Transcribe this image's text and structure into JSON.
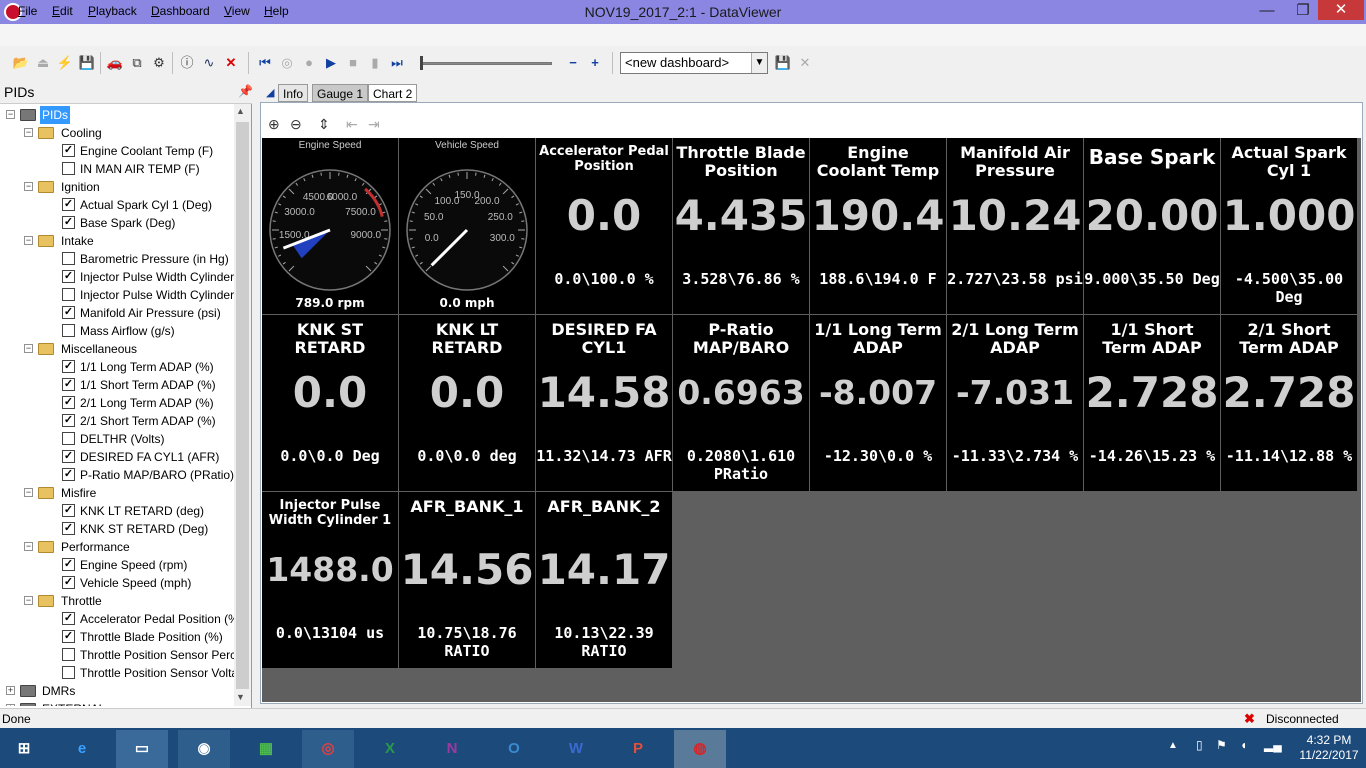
{
  "window": {
    "title": "NOV19_2017_2:1 - DataViewer",
    "minimize": "—",
    "restore": "❐",
    "close": "✕"
  },
  "menu": [
    "File",
    "Edit",
    "Playback",
    "Dashboard",
    "View",
    "Help"
  ],
  "toolbar": {
    "dashboard_select": "<new dashboard>"
  },
  "pids_panel": {
    "title": "PIDs",
    "root": "PIDs",
    "bottom_items": [
      "DMRs",
      "EXTERNAL"
    ],
    "groups": [
      {
        "name": "Cooling",
        "items": [
          {
            "label": "Engine Coolant Temp (F)",
            "checked": true
          },
          {
            "label": "IN MAN AIR TEMP (F)",
            "checked": false
          }
        ]
      },
      {
        "name": "Ignition",
        "items": [
          {
            "label": "Actual Spark Cyl 1 (Deg)",
            "checked": true
          },
          {
            "label": "Base Spark (Deg)",
            "checked": true
          }
        ]
      },
      {
        "name": "Intake",
        "items": [
          {
            "label": "Barometric Pressure (in Hg)",
            "checked": false
          },
          {
            "label": "Injector Pulse Width Cylinder",
            "checked": true
          },
          {
            "label": "Injector Pulse Width Cylinder",
            "checked": false
          },
          {
            "label": "Manifold Air Pressure (psi)",
            "checked": true
          },
          {
            "label": "Mass Airflow (g/s)",
            "checked": false
          }
        ]
      },
      {
        "name": "Miscellaneous",
        "items": [
          {
            "label": "1/1 Long Term ADAP (%)",
            "checked": true
          },
          {
            "label": "1/1 Short Term ADAP (%)",
            "checked": true
          },
          {
            "label": "2/1 Long Term ADAP (%)",
            "checked": true
          },
          {
            "label": "2/1 Short Term ADAP (%)",
            "checked": true
          },
          {
            "label": "DELTHR (Volts)",
            "checked": false
          },
          {
            "label": "DESIRED FA CYL1 (AFR)",
            "checked": true
          },
          {
            "label": "P-Ratio MAP/BARO (PRatio)",
            "checked": true
          }
        ]
      },
      {
        "name": "Misfire",
        "items": [
          {
            "label": "KNK LT RETARD (deg)",
            "checked": true
          },
          {
            "label": "KNK ST RETARD (Deg)",
            "checked": true
          }
        ]
      },
      {
        "name": "Performance",
        "items": [
          {
            "label": "Engine Speed (rpm)",
            "checked": true
          },
          {
            "label": "Vehicle Speed (mph)",
            "checked": true
          }
        ]
      },
      {
        "name": "Throttle",
        "items": [
          {
            "label": "Accelerator Pedal Position (%",
            "checked": true
          },
          {
            "label": "Throttle Blade Position (%)",
            "checked": true
          },
          {
            "label": "Throttle Position Sensor Perc",
            "checked": false
          },
          {
            "label": "Throttle Position Sensor Volta",
            "checked": false
          }
        ]
      }
    ]
  },
  "tabs": [
    "Info",
    "Gauge 1",
    "Chart 2"
  ],
  "gauges": [
    {
      "title": "Engine Speed",
      "value": "789.0 rpm",
      "ticks": [
        "1500.0",
        "3000.0",
        "4500.0",
        "6000.0",
        "7500.0",
        "9000.0"
      ],
      "fraction": 0.088
    },
    {
      "title": "Vehicle Speed",
      "value": "0.0 mph",
      "ticks": [
        "0.0",
        "50.0",
        "100.0",
        "150.0",
        "200.0",
        "250.0",
        "300.0"
      ],
      "fraction": 0.0
    }
  ],
  "cells": [
    {
      "title": "Accelerator Pedal Position",
      "value": "0.0",
      "range": "0.0\\100.0 %"
    },
    {
      "title": "Throttle Blade Position",
      "value": "4.435",
      "range": "3.528\\76.86 %"
    },
    {
      "title": "Engine Coolant Temp",
      "value": "190.4",
      "range": "188.6\\194.0 F"
    },
    {
      "title": "Manifold Air Pressure",
      "value": "10.24",
      "range": "2.727\\23.58 psi"
    },
    {
      "title": "Base Spark",
      "value": "20.00",
      "range": "9.000\\35.50 Deg"
    },
    {
      "title": "Actual Spark Cyl 1",
      "value": "1.000",
      "range": "-4.500\\35.00 Deg"
    },
    {
      "title": "KNK ST RETARD",
      "value": "0.0",
      "range": "0.0\\0.0  Deg"
    },
    {
      "title": "KNK LT RETARD",
      "value": "0.0",
      "range": "0.0\\0.0  deg"
    },
    {
      "title": "DESIRED FA CYL1",
      "value": "14.58",
      "range": "11.32\\14.73 AFR"
    },
    {
      "title": "P-Ratio MAP/BARO",
      "value": "0.6963",
      "range": "0.2080\\1.610 PRatio"
    },
    {
      "title": "1/1 Long Term ADAP",
      "value": "-8.007",
      "range": "-12.30\\0.0 %"
    },
    {
      "title": "2/1 Long Term ADAP",
      "value": "-7.031",
      "range": "-11.33\\2.734 %"
    },
    {
      "title": "1/1 Short Term ADAP",
      "value": "2.728",
      "range": "-14.26\\15.23 %"
    },
    {
      "title": "2/1 Short Term ADAP",
      "value": "2.728",
      "range": "-11.14\\12.88 %"
    },
    {
      "title": "Injector Pulse Width Cylinder 1",
      "value": "1488.0",
      "range": "0.0\\13104 us"
    },
    {
      "title": "AFR_BANK_1",
      "value": "14.56",
      "range": "10.75\\18.76 RATIO"
    },
    {
      "title": "AFR_BANK_2",
      "value": "14.17",
      "range": "10.13\\22.39 RATIO"
    }
  ],
  "status": {
    "left": "Done",
    "right": "Disconnected"
  },
  "clock": {
    "time": "4:32 PM",
    "date": "11/22/2017"
  }
}
